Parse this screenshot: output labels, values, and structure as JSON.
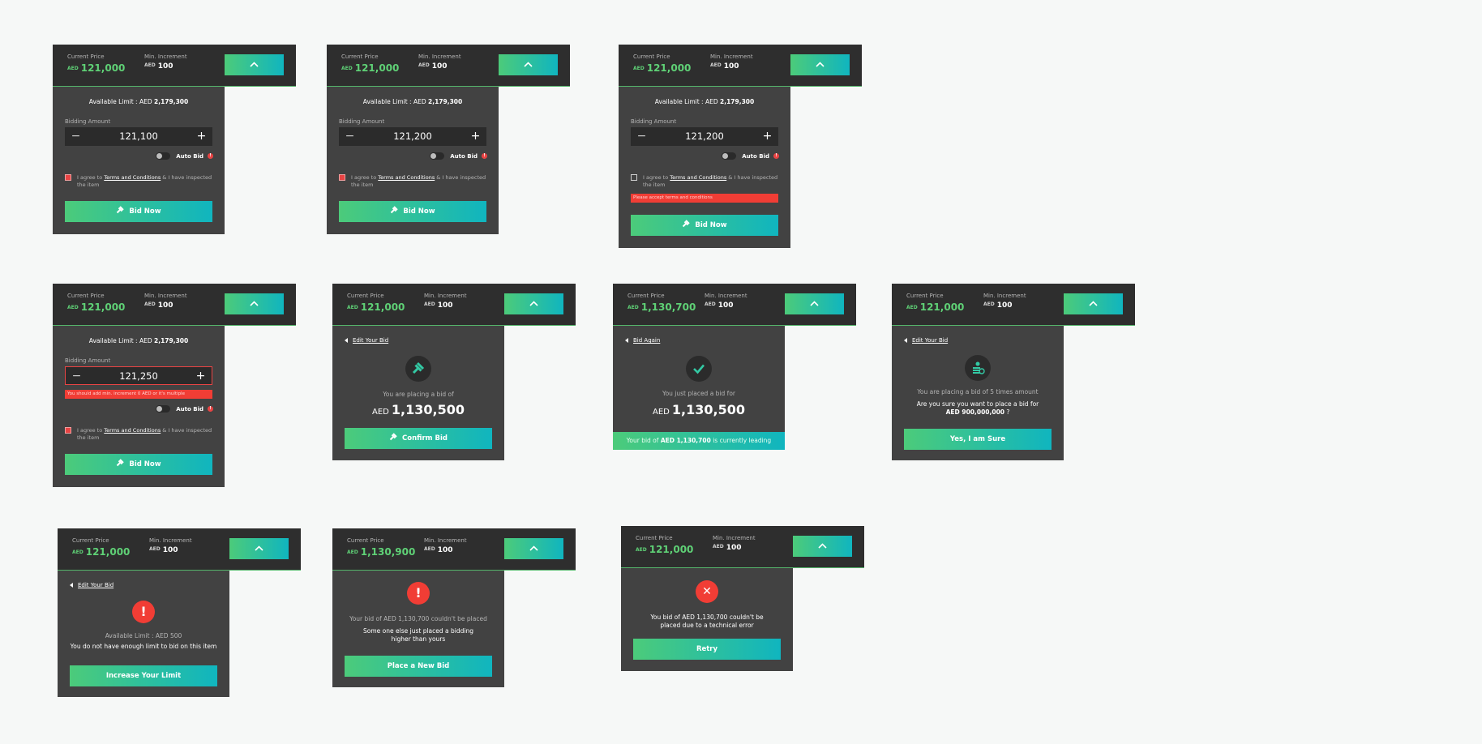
{
  "common": {
    "current_price_label": "Current Price",
    "min_increment_label": "Min. Increment",
    "aed": "AED",
    "min_increment_value": "100",
    "available_limit_prefix": "Available Limit : AED",
    "available_limit_value": "2,179,300",
    "bidding_amount_label": "Bidding Amount",
    "minus": "−",
    "plus": "+",
    "auto_bid_label": "Auto Bid",
    "info_glyph": "!",
    "terms_prefix": "I agree to",
    "terms_link": "Terms and Conditions",
    "terms_suffix": "& I have inspected the item",
    "bid_now_label": "Bid Now",
    "accent_start": "#4ccb7a",
    "accent_end": "#10b5bf",
    "error_color": "#f13d35"
  },
  "cards": {
    "c1": {
      "price": "121,000",
      "amount": "121,100"
    },
    "c2": {
      "price": "121,000",
      "amount": "121,200"
    },
    "c3": {
      "price": "121,000",
      "amount": "121,200",
      "error": "Please accept terms and conditions"
    },
    "c4": {
      "price": "121,000",
      "amount": "121,250",
      "error": "You should add min. increment 0 AED or it's multiple"
    },
    "c5": {
      "price": "121,000",
      "back": "Edit Your Bid",
      "text": "You are placing a bid of",
      "amount": "1,130,500",
      "button": "Confirm Bid"
    },
    "c6": {
      "price": "1,130,700",
      "back": "Bid Again",
      "text": "You just placed a bid for",
      "amount": "1,130,500",
      "leading_prefix": "Your bid of",
      "leading_amount": "AED 1,130,700",
      "leading_suffix": "is currently leading"
    },
    "c7": {
      "price": "121,000",
      "back": "Edit Your Bid",
      "text1": "You are placing a bid of 5 times amount",
      "text2": "Are you sure you want to place a bid for",
      "amount": "AED 900,000,000",
      "amount_suffix": "?",
      "button": "Yes, I am Sure"
    },
    "c8": {
      "price": "121,000",
      "back": "Edit Your Bid",
      "text1": "Available Limit : AED 500",
      "text2": "You do not have enough limit to bid on this item",
      "button": "Increase Your Limit",
      "icon": "!"
    },
    "c9": {
      "price": "1,130,900",
      "text1": "Your bid of AED 1,130,700 couldn't be placed",
      "text2": "Some one else just placed a bidding higher than yours",
      "button": "Place a New Bid",
      "icon": "!"
    },
    "c10": {
      "price": "121,000",
      "text1": "You bid of AED 1,130,700 couldn't be placed due to a technical error",
      "button": "Retry",
      "icon": "✕"
    }
  }
}
